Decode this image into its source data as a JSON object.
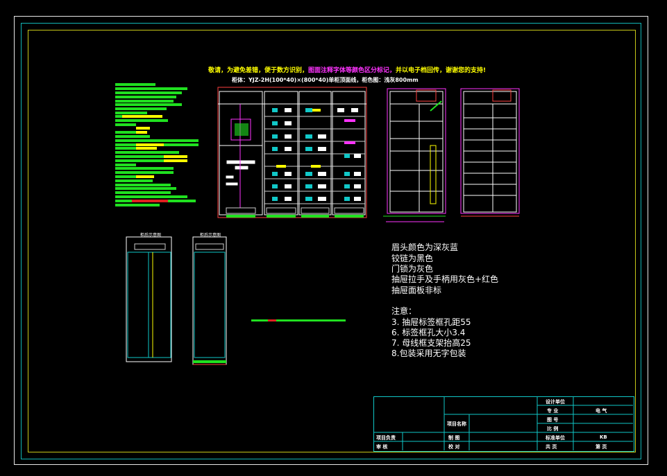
{
  "drawing": {
    "headline_yellow_1": "敬请，为避免差错，便于数方识别，",
    "headline_magenta": "图面注释字体等颜色区分标记，",
    "headline_yellow_2": "并以电子档回传，谢谢您的支持!",
    "subline": "柜体：YJZ-2H(100*40)×(800*40)单柜顶面线，柜色图：浅灰800mm"
  },
  "side_labels": {
    "left_small_cabinet": "柜后示意图",
    "right_small_cabinet": "柜后示意图"
  },
  "notes": {
    "lines": [
      "眉头颜色为深灰蓝",
      "铰链为黑色",
      "门锁为灰色",
      "抽屉拉手及手柄用灰色+红色",
      "抽屉面板非标"
    ],
    "heading": "注意：",
    "items": [
      "3.  抽屉标签框孔距55",
      "6.  标签框孔大小3.4",
      "7. 母线框支架抬高25",
      "8.包装采用无字包装"
    ]
  },
  "title_block": {
    "design_unit": "设计单位",
    "specialty_label": "专  业",
    "specialty_value": "电  气",
    "drawing_no": "图  号",
    "scale": "比  例",
    "project_name": "项目名称",
    "standard_unit": "标准单位",
    "standard_value": "KB",
    "project_lead": "项目负责",
    "drawn": "制  图",
    "review": "审  核",
    "check": "校  对",
    "page_total": "共    页",
    "page_no": "第    页"
  },
  "colors": {
    "outer_frame": "#e8e8e8",
    "cyan": "#11b6b6",
    "yellow_frame": "#c8c818",
    "green_text": "#20e020"
  }
}
